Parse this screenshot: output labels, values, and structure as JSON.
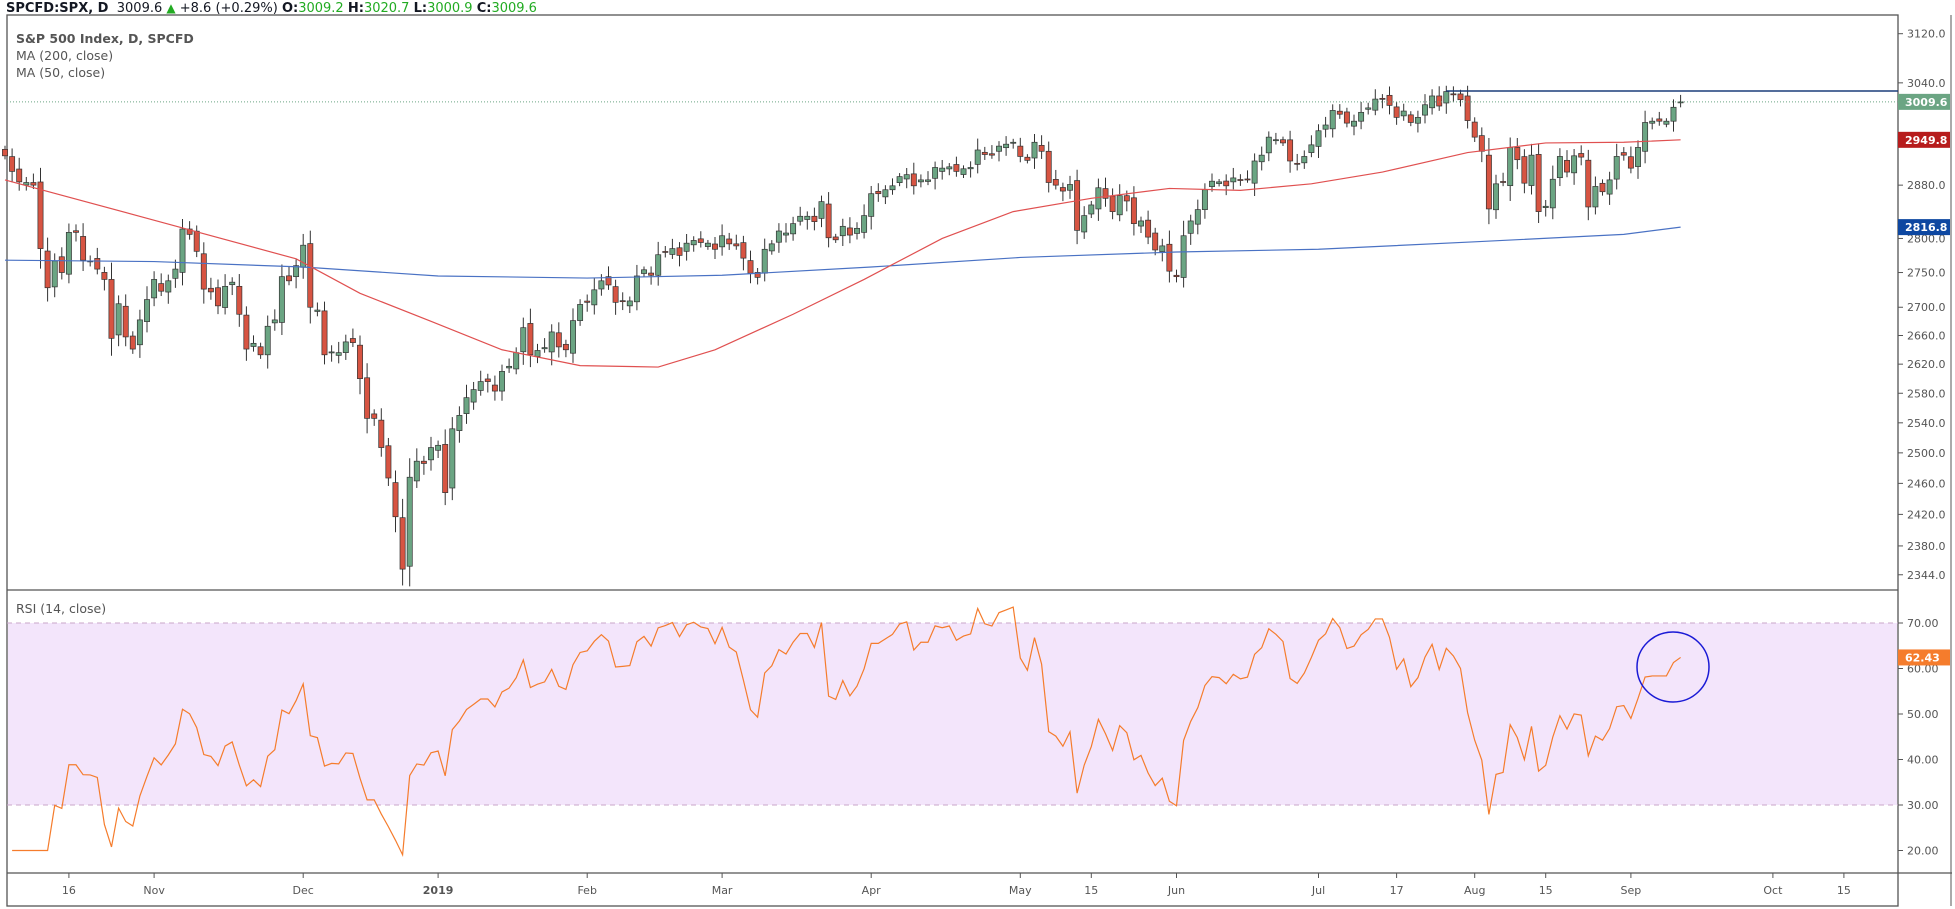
{
  "header": {
    "symbol": "SPCFD:SPX, D",
    "last": "3009.6",
    "change": "+8.6 (+0.29%)",
    "o_label": "O:",
    "o": "3009.2",
    "h_label": "H:",
    "h": "3020.7",
    "l_label": "L:",
    "l": "3000.9",
    "c_label": "C:",
    "c": "3009.6"
  },
  "legend": {
    "title": "S&P 500 Index, D, SPCFD",
    "ma200": "MA (200, close)",
    "ma50": "MA (50, close)",
    "rsi": "RSI (14, close)"
  },
  "colors": {
    "up": "#6ba583",
    "down": "#d75442",
    "ma200": "#4a72c4",
    "ma50": "#e05050",
    "rsi": "#f57c2c",
    "rsi_band": "#f3e5fb",
    "resistance": "#1c3d7a",
    "circle": "#1a1ad6"
  },
  "chart_data": [
    {
      "type": "candlestick",
      "title": "S&P 500 Index, D, SPCFD",
      "scale": "log",
      "ylim": [
        2344,
        3120
      ],
      "y_ticks": [
        "3120.0",
        "3040.0",
        "2880.0",
        "2800.0",
        "2750.0",
        "2700.0",
        "2660.0",
        "2620.0",
        "2580.0",
        "2540.0",
        "2500.0",
        "2460.0",
        "2420.0",
        "2380.0",
        "2344.0"
      ],
      "start_date": "2018-10-03",
      "closes": [
        2925,
        2901,
        2885,
        2884,
        2880,
        2785,
        2728,
        2767,
        2750,
        2809,
        2809,
        2768,
        2767,
        2755,
        2740,
        2656,
        2705,
        2658,
        2641,
        2682,
        2711,
        2740,
        2723,
        2738,
        2755,
        2814,
        2806,
        2781,
        2726,
        2722,
        2702,
        2730,
        2736,
        2690,
        2641,
        2649,
        2633,
        2673,
        2682,
        2744,
        2738,
        2760,
        2790,
        2700,
        2696,
        2633,
        2637,
        2636,
        2651,
        2650,
        2600,
        2546,
        2546,
        2507,
        2467,
        2417,
        2351,
        2468,
        2489,
        2486,
        2507,
        2510,
        2448,
        2532,
        2550,
        2574,
        2585,
        2596,
        2596,
        2583,
        2610,
        2617,
        2636,
        2671,
        2633,
        2639,
        2643,
        2665,
        2644,
        2640,
        2681,
        2704,
        2707,
        2725,
        2738,
        2732,
        2707,
        2708,
        2709,
        2745,
        2754,
        2746,
        2776,
        2780,
        2785,
        2775,
        2793,
        2797,
        2794,
        2793,
        2784,
        2804,
        2792,
        2789,
        2771,
        2749,
        2743,
        2784,
        2792,
        2811,
        2808,
        2822,
        2833,
        2833,
        2825,
        2855,
        2801,
        2798,
        2818,
        2805,
        2815,
        2834,
        2867,
        2867,
        2873,
        2879,
        2893,
        2896,
        2879,
        2888,
        2888,
        2907,
        2906,
        2908,
        2901,
        2905,
        2907,
        2934,
        2927,
        2926,
        2940,
        2943,
        2946,
        2924,
        2918,
        2946,
        2932,
        2884,
        2880,
        2871,
        2881,
        2812,
        2834,
        2850,
        2876,
        2860,
        2840,
        2864,
        2856,
        2822,
        2826,
        2802,
        2783,
        2789,
        2752,
        2744,
        2804,
        2826,
        2843,
        2873,
        2886,
        2885,
        2879,
        2891,
        2887,
        2889,
        2917,
        2926,
        2954,
        2950,
        2945,
        2917,
        2913,
        2924,
        2942,
        2964,
        2973,
        2996,
        2990,
        2976,
        2979,
        2993,
        3000,
        3014,
        3014,
        3004,
        2985,
        2995,
        2977,
        2985,
        3005,
        3019,
        3003,
        3026,
        3021,
        3013,
        2980,
        2954,
        2932,
        2844,
        2882,
        2884,
        2938,
        2919,
        2883,
        2926,
        2840,
        2848,
        2889,
        2924,
        2900,
        2925,
        2923,
        2847,
        2878,
        2870,
        2888,
        2924,
        2926,
        2906,
        2938,
        2977,
        2979,
        2979,
        2979,
        3001,
        3009.6
      ],
      "last_ohlc": {
        "open": 3009.2,
        "high": 3020.7,
        "low": 3000.9,
        "close": 3009.6
      },
      "ma200": [
        [
          "2018-10-03",
          2768
        ],
        [
          "2018-11-01",
          2766
        ],
        [
          "2018-12-03",
          2758
        ],
        [
          "2019-01-02",
          2745
        ],
        [
          "2019-02-01",
          2742
        ],
        [
          "2019-03-01",
          2746
        ],
        [
          "2019-04-01",
          2758
        ],
        [
          "2019-05-01",
          2772
        ],
        [
          "2019-06-03",
          2780
        ],
        [
          "2019-07-01",
          2784
        ],
        [
          "2019-08-01",
          2795
        ],
        [
          "2019-08-30",
          2806
        ],
        [
          "2019-09-12",
          2816.8
        ]
      ],
      "ma50": [
        [
          "2018-10-03",
          2888
        ],
        [
          "2018-10-31",
          2830
        ],
        [
          "2018-11-30",
          2770
        ],
        [
          "2018-12-14",
          2720
        ],
        [
          "2018-12-31",
          2680
        ],
        [
          "2019-01-15",
          2640
        ],
        [
          "2019-01-31",
          2618
        ],
        [
          "2019-02-15",
          2616
        ],
        [
          "2019-02-28",
          2640
        ],
        [
          "2019-03-15",
          2690
        ],
        [
          "2019-03-29",
          2740
        ],
        [
          "2019-04-15",
          2800
        ],
        [
          "2019-04-30",
          2840
        ],
        [
          "2019-05-15",
          2860
        ],
        [
          "2019-05-31",
          2875
        ],
        [
          "2019-06-14",
          2872
        ],
        [
          "2019-06-28",
          2882
        ],
        [
          "2019-07-15",
          2900
        ],
        [
          "2019-07-31",
          2930
        ],
        [
          "2019-08-15",
          2945
        ],
        [
          "2019-08-30",
          2946
        ],
        [
          "2019-09-12",
          2949.8
        ]
      ],
      "resistance_level": 3027,
      "resistance_from": "2019-07-26",
      "price_labels": [
        {
          "text": "3009.6",
          "value": 3009.6,
          "color": "#6ba583"
        },
        {
          "text": "2949.8",
          "value": 2949.8,
          "color": "#b71c1c"
        },
        {
          "text": "2816.8",
          "value": 2816.8,
          "color": "#0d47a1"
        }
      ]
    },
    {
      "type": "line",
      "title": "RSI (14, close)",
      "ylim": [
        15,
        77
      ],
      "band": [
        30,
        70
      ],
      "y_ticks": [
        "70.00",
        "60.00",
        "50.00",
        "40.00",
        "30.00",
        "20.00"
      ],
      "last_value": 62.43,
      "last_label": "62.43",
      "annotation": "circle around latest RSI values"
    }
  ],
  "x_axis": {
    "labels": [
      {
        "text": "16",
        "date": "2018-10-16"
      },
      {
        "text": "Nov",
        "date": "2018-11-01"
      },
      {
        "text": "Dec",
        "date": "2018-12-03"
      },
      {
        "text": "2019",
        "date": "2019-01-02",
        "bold": true
      },
      {
        "text": "Feb",
        "date": "2019-02-01"
      },
      {
        "text": "Mar",
        "date": "2019-03-01"
      },
      {
        "text": "Apr",
        "date": "2019-04-01"
      },
      {
        "text": "May",
        "date": "2019-05-01"
      },
      {
        "text": "15",
        "date": "2019-05-15"
      },
      {
        "text": "Jun",
        "date": "2019-06-03"
      },
      {
        "text": "Jul",
        "date": "2019-07-01"
      },
      {
        "text": "17",
        "date": "2019-07-17"
      },
      {
        "text": "Aug",
        "date": "2019-08-01"
      },
      {
        "text": "15",
        "date": "2019-08-15"
      },
      {
        "text": "Sep",
        "date": "2019-09-03"
      },
      {
        "text": "Oct",
        "date": "2019-10-01"
      },
      {
        "text": "15",
        "date": "2019-10-15"
      }
    ]
  }
}
